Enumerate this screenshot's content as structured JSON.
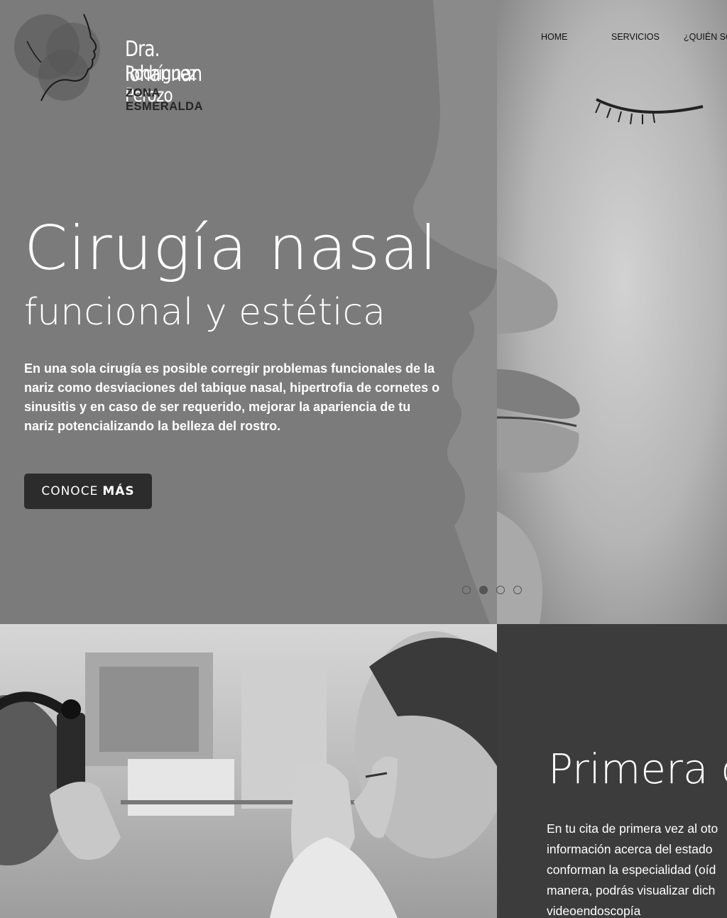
{
  "brand": {
    "name_line1": "Dra. Iohannan",
    "name_line2": "Rodríguez Perozo",
    "zone": "ZONA ESMERALDA"
  },
  "nav": {
    "items": [
      "HOME",
      "SERVICIOS",
      "¿QUIÉN SO"
    ]
  },
  "hero": {
    "title": "Cirugía nasal",
    "subtitle": "funcional y estética",
    "text": "En una sola cirugía es posible corregir problemas funcionales de la nariz como desviaciones del tabique nasal, hipertrofia de cornetes o sinusitis y en caso de ser requerido, mejorar la apariencia de tu nariz potencializando la belleza del rostro.",
    "cta_regular": "CONOCE",
    "cta_bold": "MÁS",
    "slides": 4,
    "active_slide": 2
  },
  "section2": {
    "title": "Primera c",
    "text": "En tu cita de primera vez al oto\ninformación acerca del estado\nconforman la especialidad (oíd\nmanera, podrás visualizar dich\nvideoendoscopía"
  },
  "colors": {
    "hero_overlay": "#7b7b7b",
    "cta_background": "#2c2c2c",
    "dark_panel": "#3c3c3c",
    "text_light": "#ffffff"
  }
}
